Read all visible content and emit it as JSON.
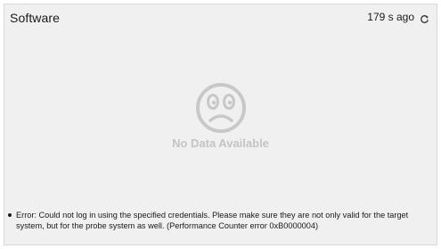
{
  "widget": {
    "title": "Software",
    "last_updated": "179 s ago",
    "refresh_icon": "refresh-icon",
    "empty_state": {
      "icon": "sad-face-icon",
      "message": "No Data Available"
    },
    "errors": [
      "Error: Could not log in using the specified credentials. Please make sure they are not only valid for the target system, but for the probe system as well. (Performance Counter error 0xB0000004)"
    ]
  },
  "colors": {
    "panel_background": "#f0f0f0",
    "empty_state_gray": "#c4c4c4",
    "text": "#1a1a1a"
  }
}
